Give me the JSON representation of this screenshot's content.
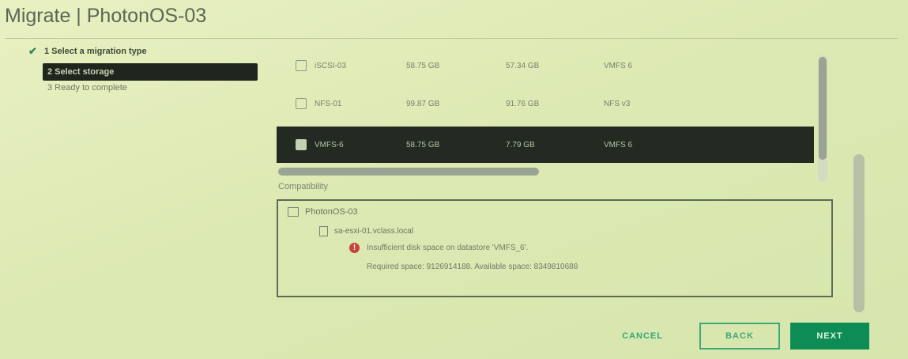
{
  "title": "Migrate | PhotonOS-03",
  "steps": [
    {
      "label": "1 Select a migration type",
      "state": "done"
    },
    {
      "label": "2 Select storage",
      "state": "active"
    },
    {
      "label": "3 Ready to complete",
      "state": "todo"
    }
  ],
  "datastores": [
    {
      "name": "iSCSI-03",
      "capacity": "58.75 GB",
      "free": "57.34 GB",
      "type": "VMFS 6",
      "selected": false
    },
    {
      "name": "NFS-01",
      "capacity": "99.87 GB",
      "free": "91.76 GB",
      "type": "NFS v3",
      "selected": false
    },
    {
      "name": "VMFS-6",
      "capacity": "58.75 GB",
      "free": "7.79 GB",
      "type": "VMFS 6",
      "selected": true
    }
  ],
  "compatibility": {
    "label": "Compatibility",
    "vm": "PhotonOS-03",
    "host": "sa-esxi-01.vclass.local",
    "error_title": "Insufficient disk space on datastore 'VMFS_6'.",
    "error_detail": "Required space: 9126914188. Available space: 8349810688"
  },
  "buttons": {
    "cancel": "CANCEL",
    "back": "BACK",
    "next": "NEXT"
  },
  "colors": {
    "accent": "#0d8c55",
    "error": "#c8413a",
    "selected_row": "#222a21"
  }
}
